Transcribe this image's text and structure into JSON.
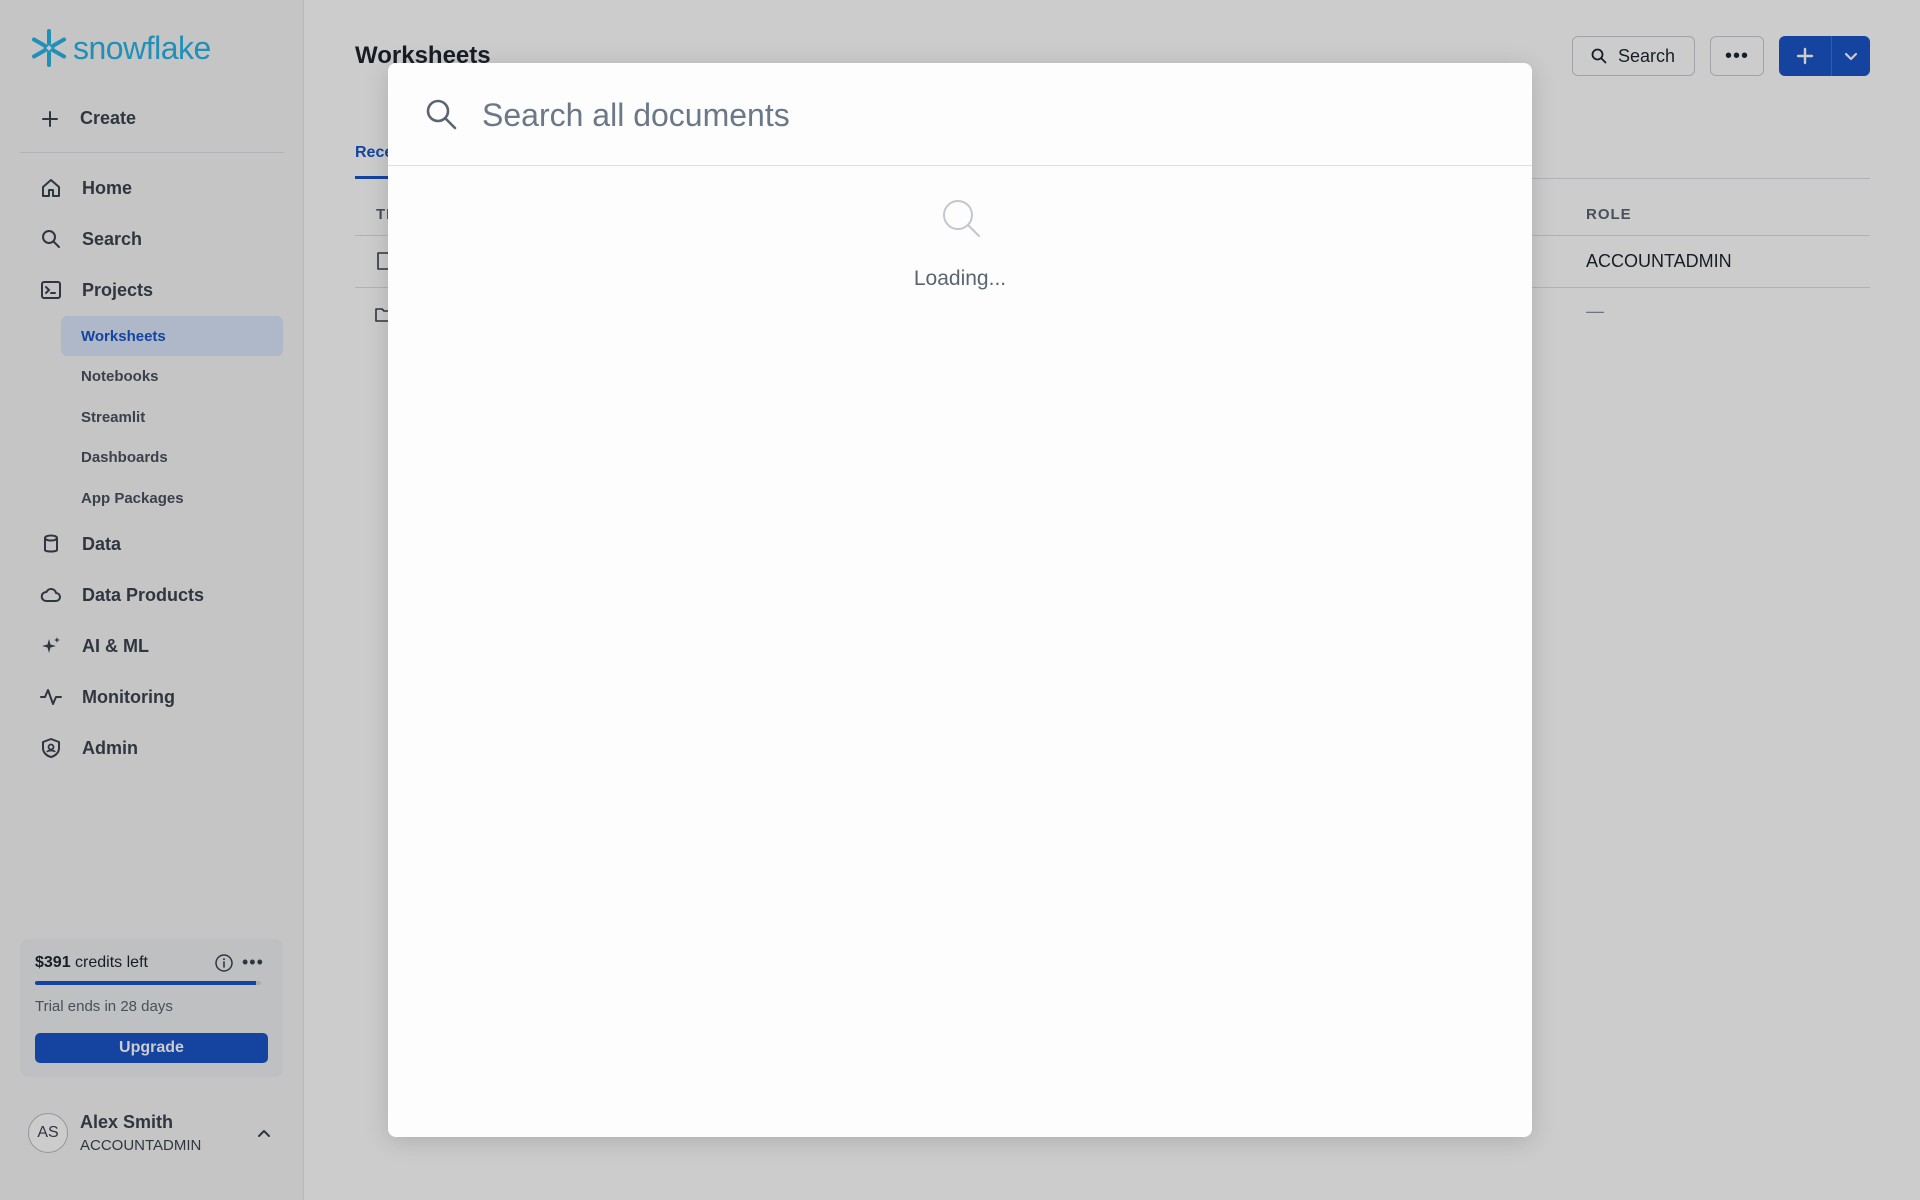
{
  "brand": {
    "logo_text": "snowflake",
    "accent": "#29b5e8",
    "primary": "#1a56c9"
  },
  "sidebar": {
    "create_label": "Create",
    "items": [
      {
        "label": "Home",
        "icon": "home-icon"
      },
      {
        "label": "Search",
        "icon": "search-icon"
      },
      {
        "label": "Projects",
        "icon": "terminal-icon"
      }
    ],
    "sub_items": [
      "Worksheets",
      "Notebooks",
      "Streamlit",
      "Dashboards",
      "App Packages"
    ],
    "active_sub_item": "Worksheets",
    "items_lower": [
      {
        "label": "Data",
        "icon": "database-icon"
      },
      {
        "label": "Data Products",
        "icon": "cloud-icon"
      },
      {
        "label": "AI & ML",
        "icon": "sparkle-icon"
      },
      {
        "label": "Monitoring",
        "icon": "activity-icon"
      },
      {
        "label": "Admin",
        "icon": "shield-icon"
      }
    ],
    "credits": {
      "amount": "$391",
      "suffix": " credits left",
      "trial_text": "Trial ends in 28 days",
      "upgrade_label": "Upgrade",
      "progress": 0.98
    },
    "user": {
      "initials": "AS",
      "name": "Alex Smith",
      "role": "ACCOUNTADMIN"
    }
  },
  "main": {
    "title": "Worksheets",
    "search_label": "Search",
    "tab_label": "Rece",
    "columns": {
      "first": "TI",
      "role": "ROLE"
    },
    "rows": [
      {
        "role": "ACCOUNTADMIN"
      },
      {
        "role": "—"
      }
    ]
  },
  "modal": {
    "placeholder": "Search all documents",
    "loading_text": "Loading..."
  }
}
